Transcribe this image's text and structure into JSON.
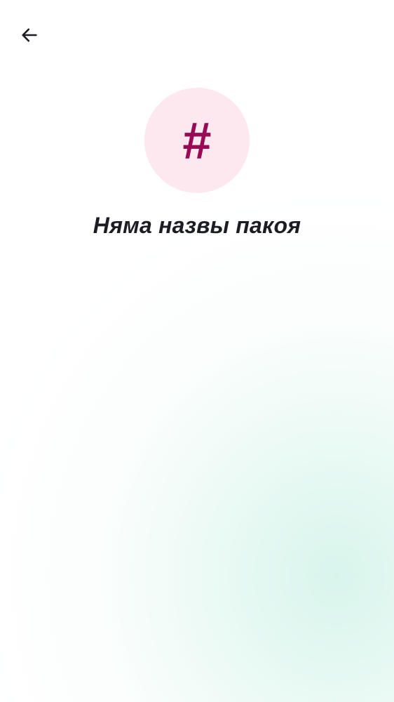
{
  "header": {
    "back_icon": "arrow-left-icon",
    "back_label": "Back"
  },
  "channel": {
    "avatar_icon": "hash-icon",
    "avatar_glyph": "#",
    "title": "Няма назвы пакоя"
  },
  "colors": {
    "avatar_background": "#fde8ef",
    "avatar_glyph": "#980a56",
    "title_text": "#1c1c24",
    "background_tint": "#e2f6f0"
  }
}
